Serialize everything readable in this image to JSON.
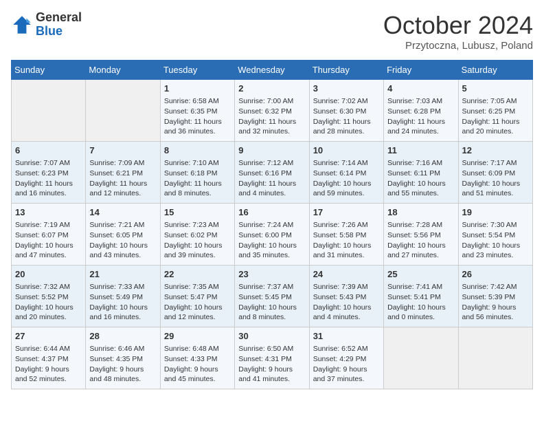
{
  "header": {
    "logo_general": "General",
    "logo_blue": "Blue",
    "title": "October 2024",
    "location": "Przytoczna, Lubusz, Poland"
  },
  "weekdays": [
    "Sunday",
    "Monday",
    "Tuesday",
    "Wednesday",
    "Thursday",
    "Friday",
    "Saturday"
  ],
  "weeks": [
    [
      {
        "day": "",
        "sunrise": "",
        "sunset": "",
        "daylight": ""
      },
      {
        "day": "",
        "sunrise": "",
        "sunset": "",
        "daylight": ""
      },
      {
        "day": "1",
        "sunrise": "Sunrise: 6:58 AM",
        "sunset": "Sunset: 6:35 PM",
        "daylight": "Daylight: 11 hours and 36 minutes."
      },
      {
        "day": "2",
        "sunrise": "Sunrise: 7:00 AM",
        "sunset": "Sunset: 6:32 PM",
        "daylight": "Daylight: 11 hours and 32 minutes."
      },
      {
        "day": "3",
        "sunrise": "Sunrise: 7:02 AM",
        "sunset": "Sunset: 6:30 PM",
        "daylight": "Daylight: 11 hours and 28 minutes."
      },
      {
        "day": "4",
        "sunrise": "Sunrise: 7:03 AM",
        "sunset": "Sunset: 6:28 PM",
        "daylight": "Daylight: 11 hours and 24 minutes."
      },
      {
        "day": "5",
        "sunrise": "Sunrise: 7:05 AM",
        "sunset": "Sunset: 6:25 PM",
        "daylight": "Daylight: 11 hours and 20 minutes."
      }
    ],
    [
      {
        "day": "6",
        "sunrise": "Sunrise: 7:07 AM",
        "sunset": "Sunset: 6:23 PM",
        "daylight": "Daylight: 11 hours and 16 minutes."
      },
      {
        "day": "7",
        "sunrise": "Sunrise: 7:09 AM",
        "sunset": "Sunset: 6:21 PM",
        "daylight": "Daylight: 11 hours and 12 minutes."
      },
      {
        "day": "8",
        "sunrise": "Sunrise: 7:10 AM",
        "sunset": "Sunset: 6:18 PM",
        "daylight": "Daylight: 11 hours and 8 minutes."
      },
      {
        "day": "9",
        "sunrise": "Sunrise: 7:12 AM",
        "sunset": "Sunset: 6:16 PM",
        "daylight": "Daylight: 11 hours and 4 minutes."
      },
      {
        "day": "10",
        "sunrise": "Sunrise: 7:14 AM",
        "sunset": "Sunset: 6:14 PM",
        "daylight": "Daylight: 10 hours and 59 minutes."
      },
      {
        "day": "11",
        "sunrise": "Sunrise: 7:16 AM",
        "sunset": "Sunset: 6:11 PM",
        "daylight": "Daylight: 10 hours and 55 minutes."
      },
      {
        "day": "12",
        "sunrise": "Sunrise: 7:17 AM",
        "sunset": "Sunset: 6:09 PM",
        "daylight": "Daylight: 10 hours and 51 minutes."
      }
    ],
    [
      {
        "day": "13",
        "sunrise": "Sunrise: 7:19 AM",
        "sunset": "Sunset: 6:07 PM",
        "daylight": "Daylight: 10 hours and 47 minutes."
      },
      {
        "day": "14",
        "sunrise": "Sunrise: 7:21 AM",
        "sunset": "Sunset: 6:05 PM",
        "daylight": "Daylight: 10 hours and 43 minutes."
      },
      {
        "day": "15",
        "sunrise": "Sunrise: 7:23 AM",
        "sunset": "Sunset: 6:02 PM",
        "daylight": "Daylight: 10 hours and 39 minutes."
      },
      {
        "day": "16",
        "sunrise": "Sunrise: 7:24 AM",
        "sunset": "Sunset: 6:00 PM",
        "daylight": "Daylight: 10 hours and 35 minutes."
      },
      {
        "day": "17",
        "sunrise": "Sunrise: 7:26 AM",
        "sunset": "Sunset: 5:58 PM",
        "daylight": "Daylight: 10 hours and 31 minutes."
      },
      {
        "day": "18",
        "sunrise": "Sunrise: 7:28 AM",
        "sunset": "Sunset: 5:56 PM",
        "daylight": "Daylight: 10 hours and 27 minutes."
      },
      {
        "day": "19",
        "sunrise": "Sunrise: 7:30 AM",
        "sunset": "Sunset: 5:54 PM",
        "daylight": "Daylight: 10 hours and 23 minutes."
      }
    ],
    [
      {
        "day": "20",
        "sunrise": "Sunrise: 7:32 AM",
        "sunset": "Sunset: 5:52 PM",
        "daylight": "Daylight: 10 hours and 20 minutes."
      },
      {
        "day": "21",
        "sunrise": "Sunrise: 7:33 AM",
        "sunset": "Sunset: 5:49 PM",
        "daylight": "Daylight: 10 hours and 16 minutes."
      },
      {
        "day": "22",
        "sunrise": "Sunrise: 7:35 AM",
        "sunset": "Sunset: 5:47 PM",
        "daylight": "Daylight: 10 hours and 12 minutes."
      },
      {
        "day": "23",
        "sunrise": "Sunrise: 7:37 AM",
        "sunset": "Sunset: 5:45 PM",
        "daylight": "Daylight: 10 hours and 8 minutes."
      },
      {
        "day": "24",
        "sunrise": "Sunrise: 7:39 AM",
        "sunset": "Sunset: 5:43 PM",
        "daylight": "Daylight: 10 hours and 4 minutes."
      },
      {
        "day": "25",
        "sunrise": "Sunrise: 7:41 AM",
        "sunset": "Sunset: 5:41 PM",
        "daylight": "Daylight: 10 hours and 0 minutes."
      },
      {
        "day": "26",
        "sunrise": "Sunrise: 7:42 AM",
        "sunset": "Sunset: 5:39 PM",
        "daylight": "Daylight: 9 hours and 56 minutes."
      }
    ],
    [
      {
        "day": "27",
        "sunrise": "Sunrise: 6:44 AM",
        "sunset": "Sunset: 4:37 PM",
        "daylight": "Daylight: 9 hours and 52 minutes."
      },
      {
        "day": "28",
        "sunrise": "Sunrise: 6:46 AM",
        "sunset": "Sunset: 4:35 PM",
        "daylight": "Daylight: 9 hours and 48 minutes."
      },
      {
        "day": "29",
        "sunrise": "Sunrise: 6:48 AM",
        "sunset": "Sunset: 4:33 PM",
        "daylight": "Daylight: 9 hours and 45 minutes."
      },
      {
        "day": "30",
        "sunrise": "Sunrise: 6:50 AM",
        "sunset": "Sunset: 4:31 PM",
        "daylight": "Daylight: 9 hours and 41 minutes."
      },
      {
        "day": "31",
        "sunrise": "Sunrise: 6:52 AM",
        "sunset": "Sunset: 4:29 PM",
        "daylight": "Daylight: 9 hours and 37 minutes."
      },
      {
        "day": "",
        "sunrise": "",
        "sunset": "",
        "daylight": ""
      },
      {
        "day": "",
        "sunrise": "",
        "sunset": "",
        "daylight": ""
      }
    ]
  ]
}
